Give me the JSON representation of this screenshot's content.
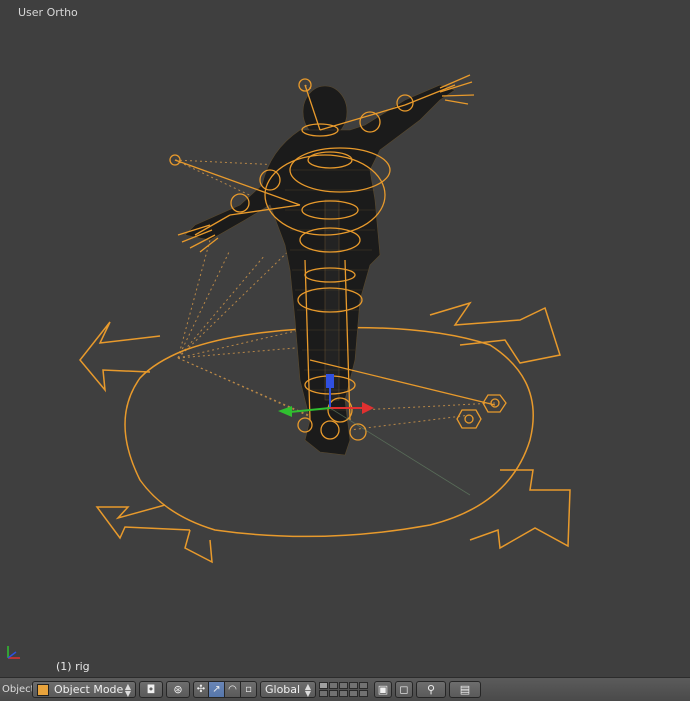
{
  "viewport": {
    "label": "User Ortho",
    "object_label": "(1) rig"
  },
  "header": {
    "editor_fragment": "Object",
    "mode": "Object Mode",
    "orientation": "Global"
  },
  "colors": {
    "background": "#3f3f3f",
    "rig_orange": "#e89a2c",
    "mesh": "#1c1c1c",
    "gizmo_red": "#e03030",
    "gizmo_green": "#30c030",
    "gizmo_blue": "#3050e0",
    "header": "#505050",
    "active_button": "#5677ab"
  },
  "icons": [
    "cube-icon",
    "viewport-shading-icon",
    "pivot-icon",
    "manipulator-icon",
    "translate-icon",
    "rotate-icon",
    "scale-icon",
    "layers-icon",
    "lock-icon",
    "snap-icon",
    "render-icon"
  ]
}
